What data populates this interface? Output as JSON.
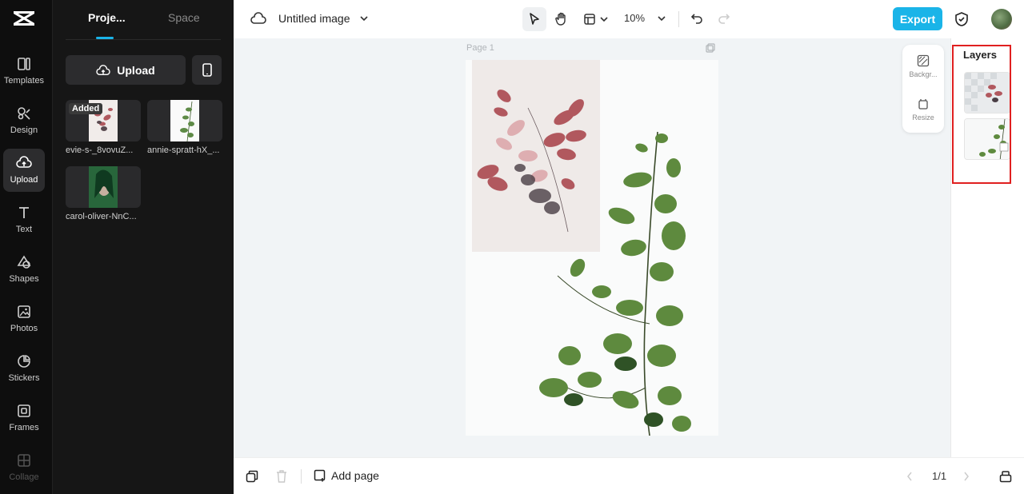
{
  "sidebar": {
    "items": [
      {
        "label": "Templates"
      },
      {
        "label": "Design"
      },
      {
        "label": "Upload"
      },
      {
        "label": "Text"
      },
      {
        "label": "Shapes"
      },
      {
        "label": "Photos"
      },
      {
        "label": "Stickers"
      },
      {
        "label": "Frames"
      },
      {
        "label": "Collage"
      }
    ]
  },
  "panel": {
    "tabs": [
      {
        "label": "Proje..."
      },
      {
        "label": "Space"
      }
    ],
    "upload_label": "Upload",
    "assets": [
      {
        "label": "evie-s-_8vovuZ...",
        "badge": "Added"
      },
      {
        "label": "annie-spratt-hX_..."
      },
      {
        "label": "carol-oliver-NnC..."
      }
    ]
  },
  "header": {
    "title": "Untitled image",
    "zoom": "10%",
    "export_label": "Export"
  },
  "canvas": {
    "page_label": "Page 1",
    "float_buttons": [
      {
        "label": "Backgr..."
      },
      {
        "label": "Resize"
      }
    ]
  },
  "layers": {
    "title": "Layers"
  },
  "footer": {
    "add_page_label": "Add page",
    "page_count": "1/1"
  },
  "colors": {
    "accent": "#1ab4e8",
    "highlight": "#e02020"
  }
}
